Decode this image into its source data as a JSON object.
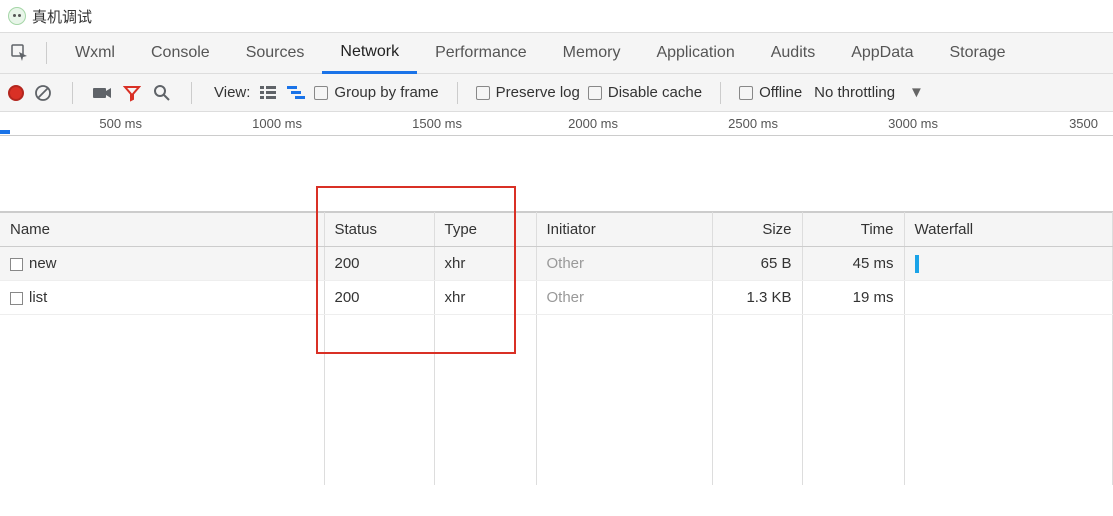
{
  "window": {
    "title": "真机调试"
  },
  "tabs": [
    {
      "label": "Wxml"
    },
    {
      "label": "Console"
    },
    {
      "label": "Sources"
    },
    {
      "label": "Network",
      "active": true
    },
    {
      "label": "Performance"
    },
    {
      "label": "Memory"
    },
    {
      "label": "Application"
    },
    {
      "label": "Audits"
    },
    {
      "label": "AppData"
    },
    {
      "label": "Storage"
    }
  ],
  "toolbar": {
    "view_label": "View:",
    "group_by_frame": "Group by frame",
    "preserve_log": "Preserve log",
    "disable_cache": "Disable cache",
    "offline": "Offline",
    "throttling": "No throttling"
  },
  "timeline": {
    "ticks": [
      "500 ms",
      "1000 ms",
      "1500 ms",
      "2000 ms",
      "2500 ms",
      "3000 ms",
      "3500 ms"
    ]
  },
  "table": {
    "headers": {
      "name": "Name",
      "status": "Status",
      "type": "Type",
      "initiator": "Initiator",
      "size": "Size",
      "time": "Time",
      "waterfall": "Waterfall"
    },
    "rows": [
      {
        "name": "new",
        "status": "200",
        "type": "xhr",
        "initiator": "Other",
        "size": "65 B",
        "time": "45 ms"
      },
      {
        "name": "list",
        "status": "200",
        "type": "xhr",
        "initiator": "Other",
        "size": "1.3 KB",
        "time": "19 ms"
      }
    ]
  }
}
